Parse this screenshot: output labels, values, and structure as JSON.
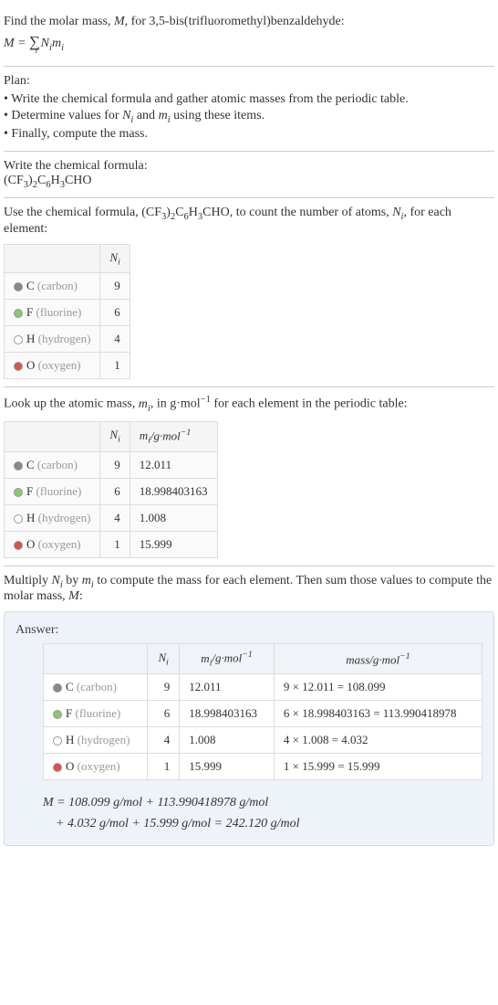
{
  "intro": {
    "line1_prefix": "Find the molar mass, ",
    "line1_var": "M",
    "line1_suffix": ", for 3,5-bis(trifluoromethyl)benzaldehyde:",
    "eq_lhs": "M",
    "eq_eq": " = ",
    "eq_sum": "∑",
    "eq_sum_idx": "i",
    "eq_rhs": " N",
    "eq_rhs_i": "i",
    "eq_rhs_m": "m",
    "eq_rhs_mi": "i"
  },
  "plan": {
    "heading": "Plan:",
    "bullets": [
      "• Write the chemical formula and gather atomic masses from the periodic table.",
      "• Determine values for Nᵢ and mᵢ using these items.",
      "• Finally, compute the mass."
    ]
  },
  "step1": {
    "heading": "Write the chemical formula:",
    "formula": "(CF₃)₂C₆H₃CHO"
  },
  "step2": {
    "heading_prefix": "Use the chemical formula, ",
    "heading_formula": "(CF₃)₂C₆H₃CHO",
    "heading_mid": ", to count the number of atoms, ",
    "heading_var": "Nᵢ",
    "heading_suffix": ", for each element:",
    "col_ni": "Nᵢ",
    "rows": [
      {
        "dot": "dot-gray",
        "sym": "C",
        "name": " (carbon)",
        "n": "9"
      },
      {
        "dot": "dot-green",
        "sym": "F",
        "name": " (fluorine)",
        "n": "6"
      },
      {
        "dot": "dot-white",
        "sym": "H",
        "name": " (hydrogen)",
        "n": "4"
      },
      {
        "dot": "dot-red",
        "sym": "O",
        "name": " (oxygen)",
        "n": "1"
      }
    ]
  },
  "step3": {
    "heading_prefix": "Look up the atomic mass, ",
    "heading_var": "mᵢ",
    "heading_mid": ", in g·mol",
    "heading_sup": "−1",
    "heading_suffix": " for each element in the periodic table:",
    "col_ni": "Nᵢ",
    "col_mi": "mᵢ/g·mol⁻¹",
    "rows": [
      {
        "dot": "dot-gray",
        "sym": "C",
        "name": " (carbon)",
        "n": "9",
        "m": "12.011"
      },
      {
        "dot": "dot-green",
        "sym": "F",
        "name": " (fluorine)",
        "n": "6",
        "m": "18.998403163"
      },
      {
        "dot": "dot-white",
        "sym": "H",
        "name": " (hydrogen)",
        "n": "4",
        "m": "1.008"
      },
      {
        "dot": "dot-red",
        "sym": "O",
        "name": " (oxygen)",
        "n": "1",
        "m": "15.999"
      }
    ]
  },
  "step4": {
    "heading_prefix": "Multiply ",
    "heading_ni": "Nᵢ",
    "heading_mid1": " by ",
    "heading_mi": "mᵢ",
    "heading_mid2": " to compute the mass for each element. Then sum those values to compute the molar mass, ",
    "heading_M": "M",
    "heading_suffix": ":"
  },
  "answer": {
    "label": "Answer:",
    "col_ni": "Nᵢ",
    "col_mi": "mᵢ/g·mol⁻¹",
    "col_mass": "mass/g·mol⁻¹",
    "rows": [
      {
        "dot": "dot-gray",
        "sym": "C",
        "name": " (carbon)",
        "n": "9",
        "m": "12.011",
        "mass": "9 × 12.011 = 108.099"
      },
      {
        "dot": "dot-green",
        "sym": "F",
        "name": " (fluorine)",
        "n": "6",
        "m": "18.998403163",
        "mass": "6 × 18.998403163 = 113.990418978"
      },
      {
        "dot": "dot-white",
        "sym": "H",
        "name": " (hydrogen)",
        "n": "4",
        "m": "1.008",
        "mass": "4 × 1.008 = 4.032"
      },
      {
        "dot": "dot-red",
        "sym": "O",
        "name": " (oxygen)",
        "n": "1",
        "m": "15.999",
        "mass": "1 × 15.999 = 15.999"
      }
    ],
    "final_line1": "M = 108.099 g/mol + 113.990418978 g/mol",
    "final_line2": "    + 4.032 g/mol + 15.999 g/mol = 242.120 g/mol"
  }
}
